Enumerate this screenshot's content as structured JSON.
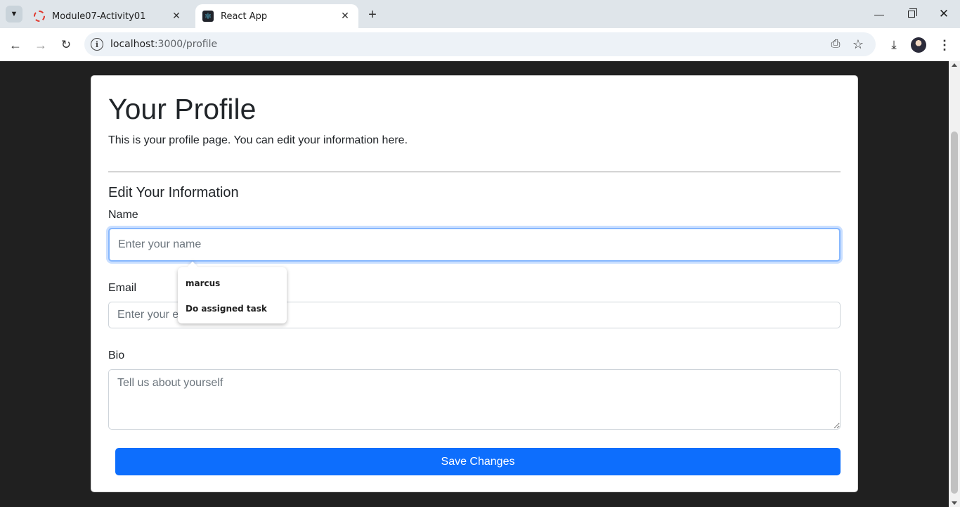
{
  "browser": {
    "tabs": [
      {
        "title": "Module07-Activity01",
        "active": false
      },
      {
        "title": "React App",
        "active": true
      }
    ],
    "url_host": "localhost",
    "url_path": ":3000/profile"
  },
  "profile": {
    "title": "Your Profile",
    "lead": "This is your profile page. You can edit your information here.",
    "section_title": "Edit Your Information",
    "name_label": "Name",
    "name_placeholder": "Enter your name",
    "email_label": "Email",
    "email_placeholder": "Enter your email",
    "bio_label": "Bio",
    "bio_placeholder": "Tell us about yourself",
    "save_label": "Save Changes"
  },
  "autofill": {
    "suggestions": [
      "marcus",
      "Do assigned task"
    ]
  },
  "colors": {
    "primary": "#0d6efd",
    "focus_ring": "#86b7fe",
    "page_bg": "#202020"
  }
}
